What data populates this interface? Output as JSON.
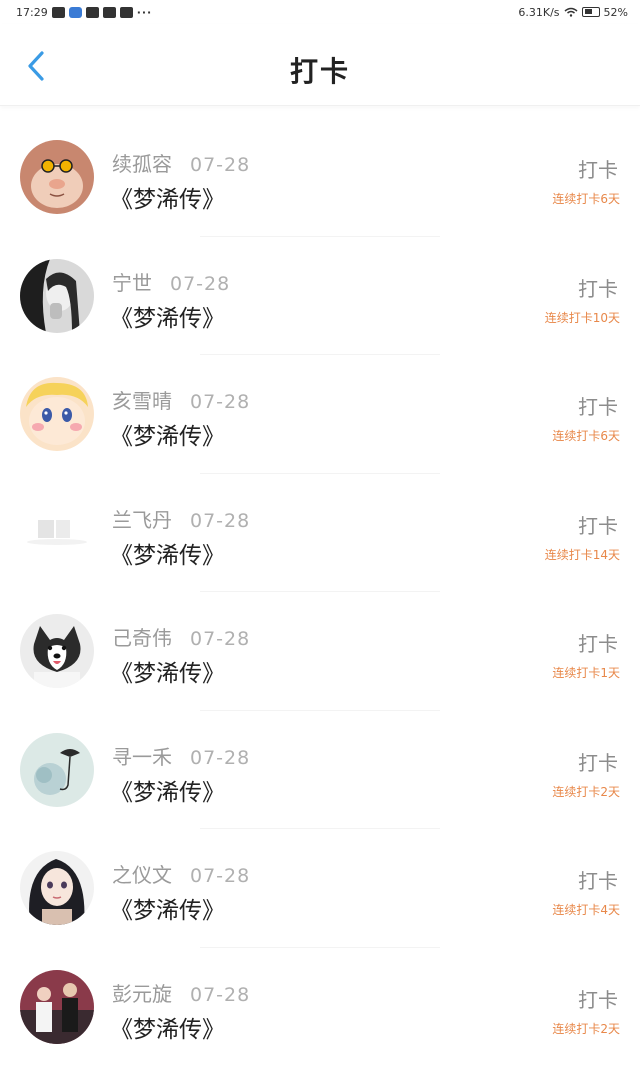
{
  "status_bar": {
    "time": "17:29",
    "network_speed": "6.31K/s",
    "battery": "52%",
    "more": "···"
  },
  "header": {
    "title": "打卡",
    "back_icon": "chevron-left-icon",
    "accent_color": "#3a9be5"
  },
  "theme": {
    "streak_color": "#e8884a",
    "muted_text": "#9a9a9a"
  },
  "entries": [
    {
      "name": "续孤容",
      "date": "07-28",
      "book": "《梦浠传》",
      "action": "打卡",
      "streak": "连续打卡6天"
    },
    {
      "name": "宁世",
      "date": "07-28",
      "book": "《梦浠传》",
      "action": "打卡",
      "streak": "连续打卡10天"
    },
    {
      "name": "亥雪晴",
      "date": "07-28",
      "book": "《梦浠传》",
      "action": "打卡",
      "streak": "连续打卡6天"
    },
    {
      "name": "兰飞丹",
      "date": "07-28",
      "book": "《梦浠传》",
      "action": "打卡",
      "streak": "连续打卡14天"
    },
    {
      "name": "己奇伟",
      "date": "07-28",
      "book": "《梦浠传》",
      "action": "打卡",
      "streak": "连续打卡1天"
    },
    {
      "name": "寻一禾",
      "date": "07-28",
      "book": "《梦浠传》",
      "action": "打卡",
      "streak": "连续打卡2天"
    },
    {
      "name": "之仪文",
      "date": "07-28",
      "book": "《梦浠传》",
      "action": "打卡",
      "streak": "连续打卡4天"
    },
    {
      "name": "彭元旋",
      "date": "07-28",
      "book": "《梦浠传》",
      "action": "打卡",
      "streak": "连续打卡2天"
    }
  ]
}
